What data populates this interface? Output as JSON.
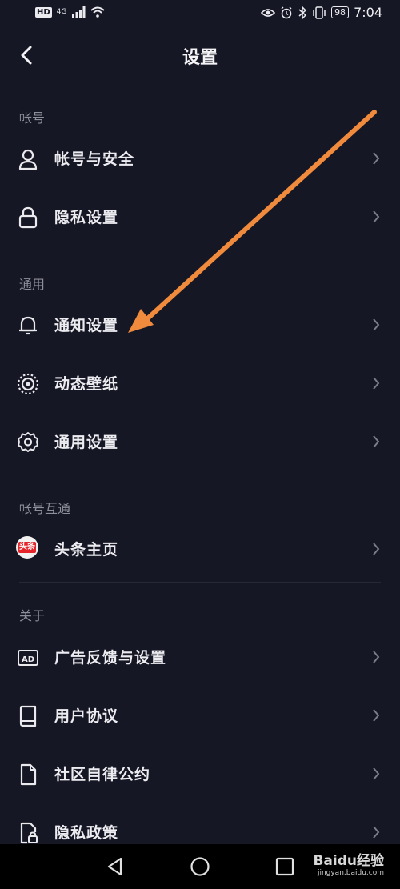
{
  "status_bar": {
    "left_badge": "HD",
    "network": "4G",
    "battery": "98",
    "time": "7:04"
  },
  "header": {
    "title": "设置"
  },
  "sections": [
    {
      "label": "帐号",
      "items": [
        {
          "label": "帐号与安全"
        },
        {
          "label": "隐私设置"
        }
      ]
    },
    {
      "label": "通用",
      "items": [
        {
          "label": "通知设置"
        },
        {
          "label": "动态壁纸"
        },
        {
          "label": "通用设置"
        }
      ]
    },
    {
      "label": "帐号互通",
      "items": [
        {
          "label": "头条主页",
          "badge": "头条"
        }
      ]
    },
    {
      "label": "关于",
      "items": [
        {
          "label": "广告反馈与设置"
        },
        {
          "label": "用户协议"
        },
        {
          "label": "社区自律公约"
        },
        {
          "label": "隐私政策"
        }
      ]
    }
  ],
  "watermark": {
    "brand": "Baidu经验",
    "url": "jingyan.baidu.com"
  },
  "colors": {
    "background": "#161724",
    "annotation_arrow": "#f08a3c",
    "toutiao_red": "#e5252b"
  }
}
